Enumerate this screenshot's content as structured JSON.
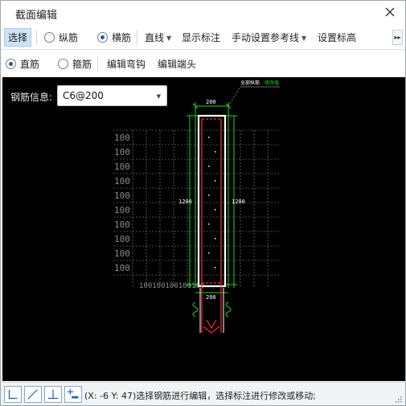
{
  "window": {
    "title": "截面编辑"
  },
  "toolbar1": {
    "select_label": "选择",
    "longitudinal_label": "纵筋",
    "transverse_label": "横筋",
    "line_label": "直线",
    "show_dim_label": "显示标注",
    "manual_ref_label": "手动设置参考线",
    "set_elevation_label": "设置标高",
    "selected_mode": "横筋"
  },
  "toolbar2": {
    "straight_label": "直筋",
    "stirrup_label": "箍筋",
    "edit_hook_label": "编辑弯钩",
    "edit_end_label": "编辑端头",
    "selected_mode": "直筋"
  },
  "canvas": {
    "rebar_info_label": "钢筋信息:",
    "rebar_info_value": "C6@200",
    "grid_labels": [
      "100",
      "100",
      "100",
      "100",
      "100",
      "100",
      "100",
      "100",
      "100",
      "100"
    ],
    "bottom_grid_label": "100100100100100",
    "dim_top": "200",
    "dim_bottom": "200",
    "dim_left": "1200",
    "dim_right": "1200",
    "callout_white": "全部纵筋",
    "callout_green": "修改值",
    "colors": {
      "background": "#000000",
      "grid": "#8c8c8c",
      "outline": "#ffffff",
      "dimension": "#1fd21f",
      "rebar": "#ff2a2a"
    }
  },
  "status": {
    "text": "(X: -6 Y: 47)选择钢筋进行编辑，选择标注进行修改或移动;"
  }
}
